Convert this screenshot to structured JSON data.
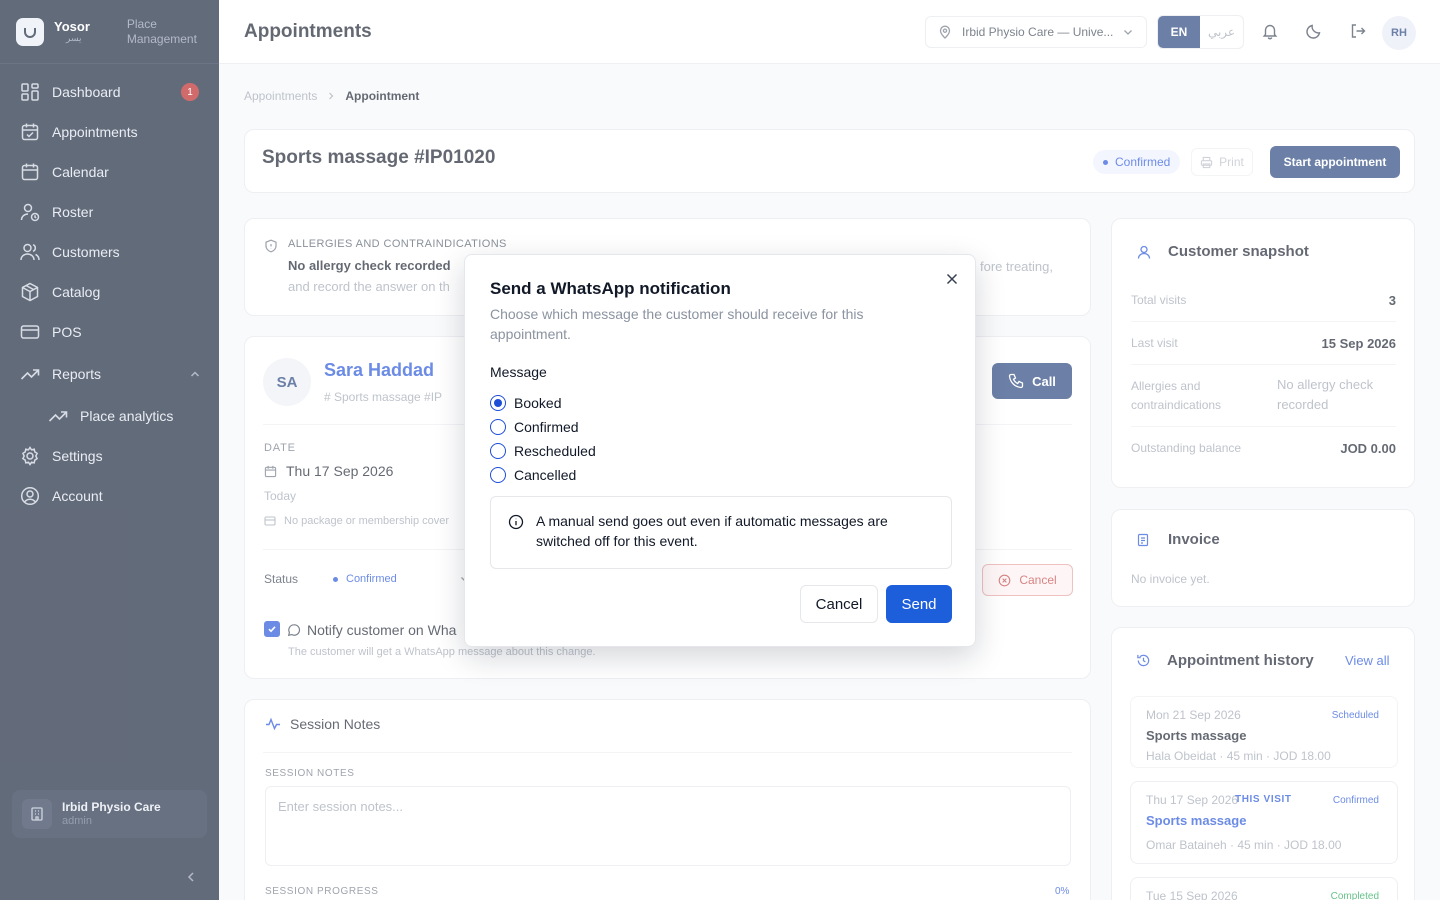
{
  "brand": {
    "name": "Yosor",
    "sub": "يسر",
    "tagline_1": "Place",
    "tagline_2": "Management"
  },
  "sidebar": {
    "items": [
      {
        "label": "Dashboard",
        "icon": "grid-icon",
        "badge": "1"
      },
      {
        "label": "Appointments",
        "icon": "calendar-check-icon"
      },
      {
        "label": "Calendar",
        "icon": "calendar-icon"
      },
      {
        "label": "Roster",
        "icon": "user-clock-icon"
      },
      {
        "label": "Customers",
        "icon": "users-icon"
      },
      {
        "label": "Catalog",
        "icon": "box-icon"
      },
      {
        "label": "POS",
        "icon": "credit-card-icon"
      },
      {
        "label": "Reports",
        "icon": "trending-up-icon",
        "expanded": true
      },
      {
        "label": "Place analytics",
        "icon": "trending-up-icon"
      },
      {
        "label": "Settings",
        "icon": "gear-icon"
      },
      {
        "label": "Account",
        "icon": "user-circle-icon"
      }
    ],
    "footer": {
      "name": "Irbid Physio Care",
      "role": "admin"
    }
  },
  "header": {
    "title": "Appointments",
    "place": "Irbid Physio Care — Unive...",
    "lang_en": "EN",
    "lang_ar": "عربي",
    "avatar": "RH"
  },
  "breadcrumb": {
    "parent": "Appointments",
    "current": "Appointment"
  },
  "appointment": {
    "title": "Sports massage #IP01020",
    "status": "Confirmed",
    "print": "Print",
    "start": "Start appointment"
  },
  "allergy": {
    "label": "ALLERGIES AND CONTRAINDICATIONS",
    "title": "No allergy check recorded",
    "line2": "and record the answer on th",
    "tail": "fore treating,"
  },
  "customer": {
    "initials": "SA",
    "name": "Sara Haddad",
    "meta": "#  Sports massage  #IP",
    "call": "Call",
    "date_label": "DATE",
    "date": "Thu 17 Sep 2026",
    "date_sub": "Today",
    "package": "No package or membership cover",
    "status_label": "Status",
    "status_value": "Confirmed",
    "cancel": "Cancel",
    "notify": "Notify customer on Wha",
    "notify_sub": "The customer will get a WhatsApp message about this change."
  },
  "notes": {
    "title": "Session Notes",
    "label": "SESSION NOTES",
    "placeholder": "Enter session notes...",
    "progress_label": "SESSION PROGRESS",
    "progress_value": "0%"
  },
  "snapshot": {
    "title": "Customer snapshot",
    "total_visits_k": "Total visits",
    "total_visits_v": "3",
    "last_visit_k": "Last visit",
    "last_visit_v": "15 Sep 2026",
    "allergies_k": "Allergies and contraindications",
    "allergies_v": "No allergy check recorded",
    "balance_k": "Outstanding balance",
    "balance_v": "JOD 0.00"
  },
  "invoice": {
    "title": "Invoice",
    "empty": "No invoice yet."
  },
  "history": {
    "title": "Appointment history",
    "view_all": "View all",
    "items": [
      {
        "date": "Mon 21 Sep 2026",
        "tag": "",
        "status": "Scheduled",
        "name": "Sports massage",
        "meta": "Hala Obeidat · 45 min · JOD 18.00"
      },
      {
        "date": "Thu 17 Sep 2026",
        "tag": "THIS VISIT",
        "status": "Confirmed",
        "name": "Sports massage",
        "meta": "Omar Bataineh · 45 min · JOD 18.00"
      },
      {
        "date": "Tue 15 Sep 2026",
        "tag": "",
        "status": "Completed",
        "name": "",
        "meta": ""
      }
    ]
  },
  "modal": {
    "title": "Send a WhatsApp notification",
    "description": "Choose which message the customer should receive for this appointment.",
    "message_label": "Message",
    "options": [
      "Booked",
      "Confirmed",
      "Rescheduled",
      "Cancelled"
    ],
    "selected": "Booked",
    "info": "A manual send goes out even if automatic messages are switched off for this event.",
    "cancel": "Cancel",
    "send": "Send"
  },
  "colors": {
    "sidebar_bg": "#0f1c33",
    "primary": "#1d3b79",
    "accent": "#1d5fdb"
  }
}
